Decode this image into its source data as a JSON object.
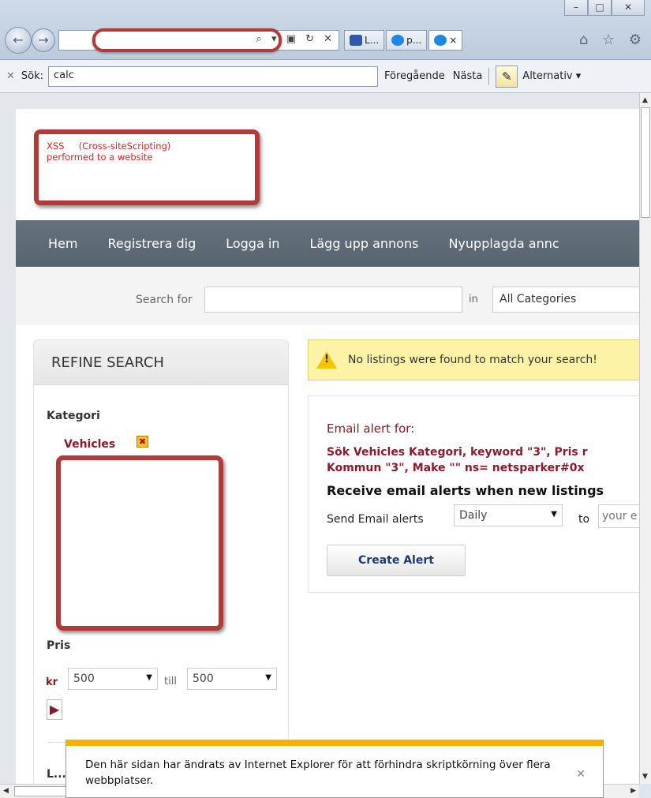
{
  "browser": {
    "window_buttons": [
      "–",
      "□",
      "✕"
    ],
    "address_icons": "⌕ ▾ ▣ ↻ ✕",
    "tabs": [
      {
        "label": "L...",
        "icon_color": "#3355aa"
      },
      {
        "label": "p...",
        "icon_color": "#1e88e5"
      },
      {
        "label": "×",
        "icon_color": "#1e88e5"
      }
    ],
    "toolbar_icons": "⌂ ☆ ⚙"
  },
  "findbar": {
    "close": "✕",
    "label": "Sök:",
    "query": "calc",
    "previous": "Föregående",
    "next": "Nästa",
    "options": "Alternativ ▾"
  },
  "popup": {
    "text": "XSS     (Cross-siteScripting)\nperformed to a website"
  },
  "nav": {
    "items": [
      "Hem",
      "Registrera dig",
      "Logga in",
      "Lägg upp annons",
      "Nyupplagda annc"
    ]
  },
  "search": {
    "label": "Search for",
    "in_label": "in",
    "category": "All Categories"
  },
  "sidebar": {
    "title": "REFINE SEARCH",
    "kategori": "Kategori",
    "vehicles": "Vehicles",
    "pris": "Pris",
    "kr": "kr",
    "from": "500",
    "till": "till",
    "to": "500",
    "next_label": "L..."
  },
  "main": {
    "no_listings": "No listings were found to match your search!",
    "alert_title": "Email alert for:",
    "alert_desc_1": "Sök Vehicles Kategori, keyword \"3\", Pris r",
    "alert_desc_2": "Kommun \"3\", Make \"\" ns= netsparker#0x",
    "receive": "Receive email alerts when new listings",
    "send_label": "Send Email alerts",
    "frequency": "Daily",
    "to_label": "to",
    "email_placeholder": "your e",
    "create_button": "Create Alert"
  },
  "notification": {
    "text": "Den här sidan har ändrats av Internet Explorer för att förhindra skriptkörning över flera webbplatser.",
    "close": "✕"
  },
  "colors": {
    "accent": "#8b1a2b",
    "nav_bg": "#5f6b77",
    "redaction": "#b33a3a",
    "warning": "#fdf3a6",
    "notification": "#f0b400"
  }
}
